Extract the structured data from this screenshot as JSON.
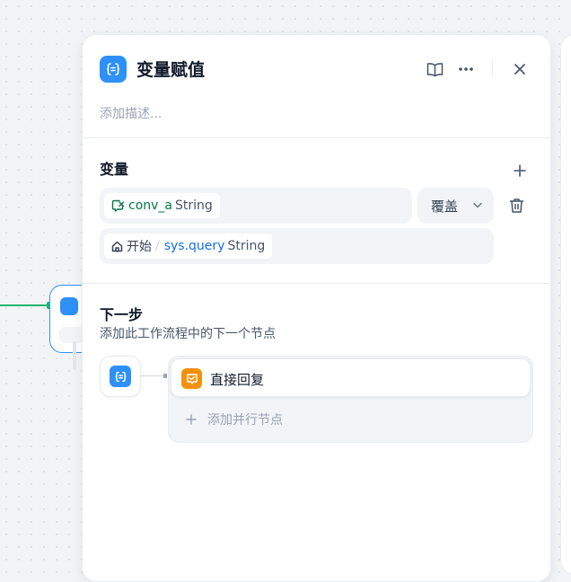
{
  "panel": {
    "title": "变量赋值",
    "description_placeholder": "添加描述..."
  },
  "variables": {
    "section_title": "变量",
    "assigned_var": {
      "name": "conv_a",
      "type": "String"
    },
    "mode": "覆盖",
    "source": {
      "node": "开始",
      "separator": "/",
      "name": "sys.query",
      "type": "String"
    }
  },
  "next_step": {
    "title": "下一步",
    "subtitle": "添加此工作流程中的下一个节点",
    "next_node_label": "直接回复",
    "add_parallel_label": "添加并行节点"
  },
  "icons": {
    "assigner": "variable-assigner-icon",
    "docs": "book-icon",
    "more": "more-icon",
    "close": "close-icon",
    "add": "plus-icon",
    "delete": "trash-icon",
    "conversation_var": "conversation-variable-icon",
    "start": "home-icon",
    "answer": "answer-icon"
  },
  "colors": {
    "primary": "#2e90fa",
    "answer_node": "#f79009",
    "conversation_var": "#067647",
    "system_var": "#1570ef",
    "edge": "#12b76a"
  }
}
